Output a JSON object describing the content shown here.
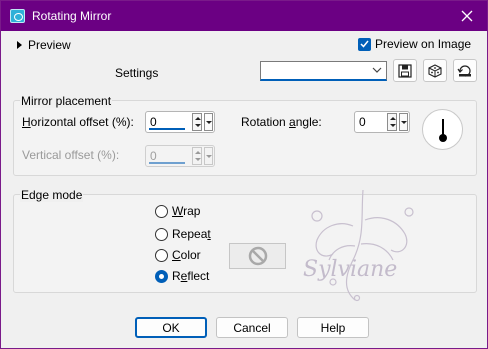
{
  "window": {
    "title": "Rotating Mirror",
    "accent": "#6b0083"
  },
  "preview": {
    "toggle_label": "Preview",
    "preview_on_image_label": "Preview on Image",
    "preview_on_image_checked": true
  },
  "settings": {
    "label": "Settings",
    "value": ""
  },
  "mirror_placement": {
    "title": "Mirror placement",
    "horizontal_offset": {
      "label_pre": "",
      "label_u": "H",
      "label_post": "orizontal offset (%):",
      "value": "0"
    },
    "vertical_offset": {
      "label": "Vertical offset (%):",
      "value": "0",
      "disabled": true
    },
    "rotation_angle": {
      "label_pre": "Rotation ",
      "label_u": "a",
      "label_post": "ngle:",
      "value": "0"
    }
  },
  "edge_mode": {
    "title": "Edge mode",
    "options": [
      {
        "pre": "",
        "u": "W",
        "post": "rap",
        "checked": false
      },
      {
        "pre": "Repea",
        "u": "t",
        "post": "",
        "checked": false
      },
      {
        "pre": "",
        "u": "C",
        "post": "olor",
        "checked": false
      },
      {
        "pre": "R",
        "u": "e",
        "post": "flect",
        "checked": true
      }
    ]
  },
  "watermark_text": "Sylviane",
  "buttons": {
    "ok": "OK",
    "cancel": "Cancel",
    "help": "Help"
  }
}
